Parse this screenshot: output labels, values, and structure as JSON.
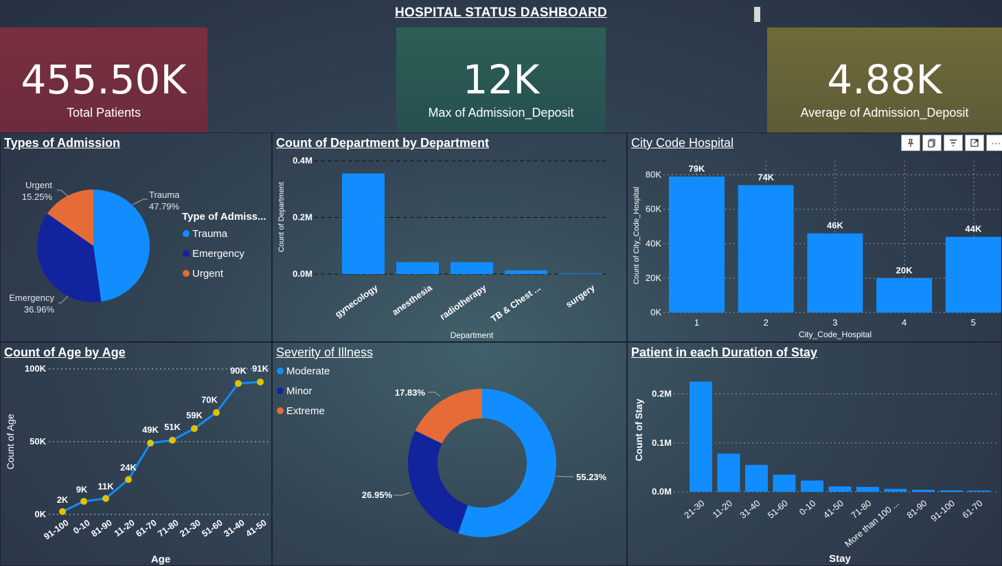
{
  "dashboard": {
    "title": "HOSPITAL STATUS DASHBOARD"
  },
  "kpis": [
    {
      "value": "455.50K",
      "label": "Total Patients",
      "color": "#6b2c3e"
    },
    {
      "value": "12K",
      "label": "Max of Admission_Deposit",
      "color": "#274f50"
    },
    {
      "value": "4.88K",
      "label": "Average of Admission_Deposit",
      "color": "#5e5b38"
    }
  ],
  "colors": {
    "trauma": "#118dff",
    "emergency": "#12239e",
    "urgent": "#e66c37",
    "bar": "#118dff",
    "line": "#118dff",
    "marker": "#e0c100",
    "background": "#2b3647"
  },
  "visual_toolbar": {
    "icons": [
      "pin-icon",
      "copy-icon",
      "filter-icon",
      "focus-mode-icon",
      "more-options-icon"
    ],
    "more": "···"
  },
  "panels": {
    "admission": {
      "title": "Types of Admission",
      "legend_title": "Type of Admiss...",
      "legend": [
        "Trauma",
        "Emergency",
        "Urgent"
      ],
      "slice_labels": [
        {
          "name": "Trauma",
          "pct": "47.79%"
        },
        {
          "name": "Emergency",
          "pct": "36.96%"
        },
        {
          "name": "Urgent",
          "pct": "15.25%"
        }
      ]
    },
    "department": {
      "title": "Count of Department by Department"
    },
    "city": {
      "title": "City Code Hospital"
    },
    "age": {
      "title": "Count of Age by Age"
    },
    "severity": {
      "title": "Severity of Illness",
      "legend": [
        "Moderate",
        "Minor",
        "Extreme"
      ],
      "slice_labels": [
        "55.23%",
        "26.95%",
        "17.83%"
      ]
    },
    "stay": {
      "title": "Patient in each Duration of Stay"
    }
  },
  "chart_data": [
    {
      "id": "admission",
      "type": "pie",
      "title": "Types of Admission",
      "legend_title": "Type of Admiss...",
      "categories": [
        "Trauma",
        "Emergency",
        "Urgent"
      ],
      "values": [
        47.79,
        36.96,
        15.25
      ],
      "colors": [
        "#118dff",
        "#12239e",
        "#e66c37"
      ],
      "legend_position": "right"
    },
    {
      "id": "department",
      "type": "bar",
      "title": "Count of Department by Department",
      "xlabel": "Department",
      "ylabel": "Count of Department",
      "categories": [
        "gynecology",
        "anesthesia",
        "radiotherapy",
        "TB & Chest ...",
        "surgery"
      ],
      "values": [
        355000,
        42000,
        42000,
        13000,
        2000
      ],
      "ylim": [
        0,
        400000
      ],
      "yticks": [
        0,
        200000,
        400000
      ],
      "ytick_labels": [
        "0.0M",
        "0.2M",
        "0.4M"
      ],
      "grid": true
    },
    {
      "id": "city",
      "type": "bar",
      "title": "City Code Hospital",
      "xlabel": "City_Code_Hospital",
      "ylabel": "Count of City_Code_Hospital",
      "categories": [
        "1",
        "2",
        "3",
        "4",
        "5"
      ],
      "values": [
        79000,
        74000,
        46000,
        20000,
        44000
      ],
      "data_labels": [
        "79K",
        "74K",
        "46K",
        "20K",
        "44K"
      ],
      "ylim": [
        0,
        85000
      ],
      "yticks": [
        0,
        20000,
        40000,
        60000,
        80000
      ],
      "ytick_labels": [
        "0K",
        "20K",
        "40K",
        "60K",
        "80K"
      ],
      "grid": true
    },
    {
      "id": "age",
      "type": "line",
      "title": "Count of Age by Age",
      "xlabel": "Age",
      "ylabel": "Count of Age",
      "categories": [
        "91-100",
        "0-10",
        "81-90",
        "11-20",
        "61-70",
        "71-80",
        "21-30",
        "51-60",
        "31-40",
        "41-50"
      ],
      "values": [
        2000,
        9000,
        11000,
        24000,
        49000,
        51000,
        59000,
        70000,
        90000,
        91000
      ],
      "data_labels": [
        "2K",
        "9K",
        "11K",
        "24K",
        "49K",
        "51K",
        "59K",
        "70K",
        "90K",
        "91K"
      ],
      "ylim": [
        0,
        100000
      ],
      "yticks": [
        0,
        50000,
        100000
      ],
      "ytick_labels": [
        "0K",
        "50K",
        "100K"
      ],
      "grid": true
    },
    {
      "id": "severity",
      "type": "pie",
      "title": "Severity of Illness",
      "donut": true,
      "categories": [
        "Moderate",
        "Minor",
        "Extreme"
      ],
      "values": [
        55.23,
        26.95,
        17.83
      ],
      "colors": [
        "#118dff",
        "#12239e",
        "#e66c37"
      ],
      "legend_position": "top-left"
    },
    {
      "id": "stay",
      "type": "bar",
      "title": "Patient in each Duration of Stay",
      "xlabel": "Stay",
      "ylabel": "Count of Stay",
      "categories": [
        "21-30",
        "11-20",
        "31-40",
        "51-60",
        "0-10",
        "41-50",
        "71-80",
        "More than 100 ...",
        "81-90",
        "91-100",
        "61-70"
      ],
      "values": [
        225000,
        78000,
        55000,
        35000,
        23000,
        11000,
        10000,
        6000,
        4000,
        3000,
        2500
      ],
      "ylim": [
        0,
        240000
      ],
      "yticks": [
        0,
        100000,
        200000
      ],
      "ytick_labels": [
        "0.0M",
        "0.1M",
        "0.2M"
      ],
      "grid": true
    }
  ]
}
